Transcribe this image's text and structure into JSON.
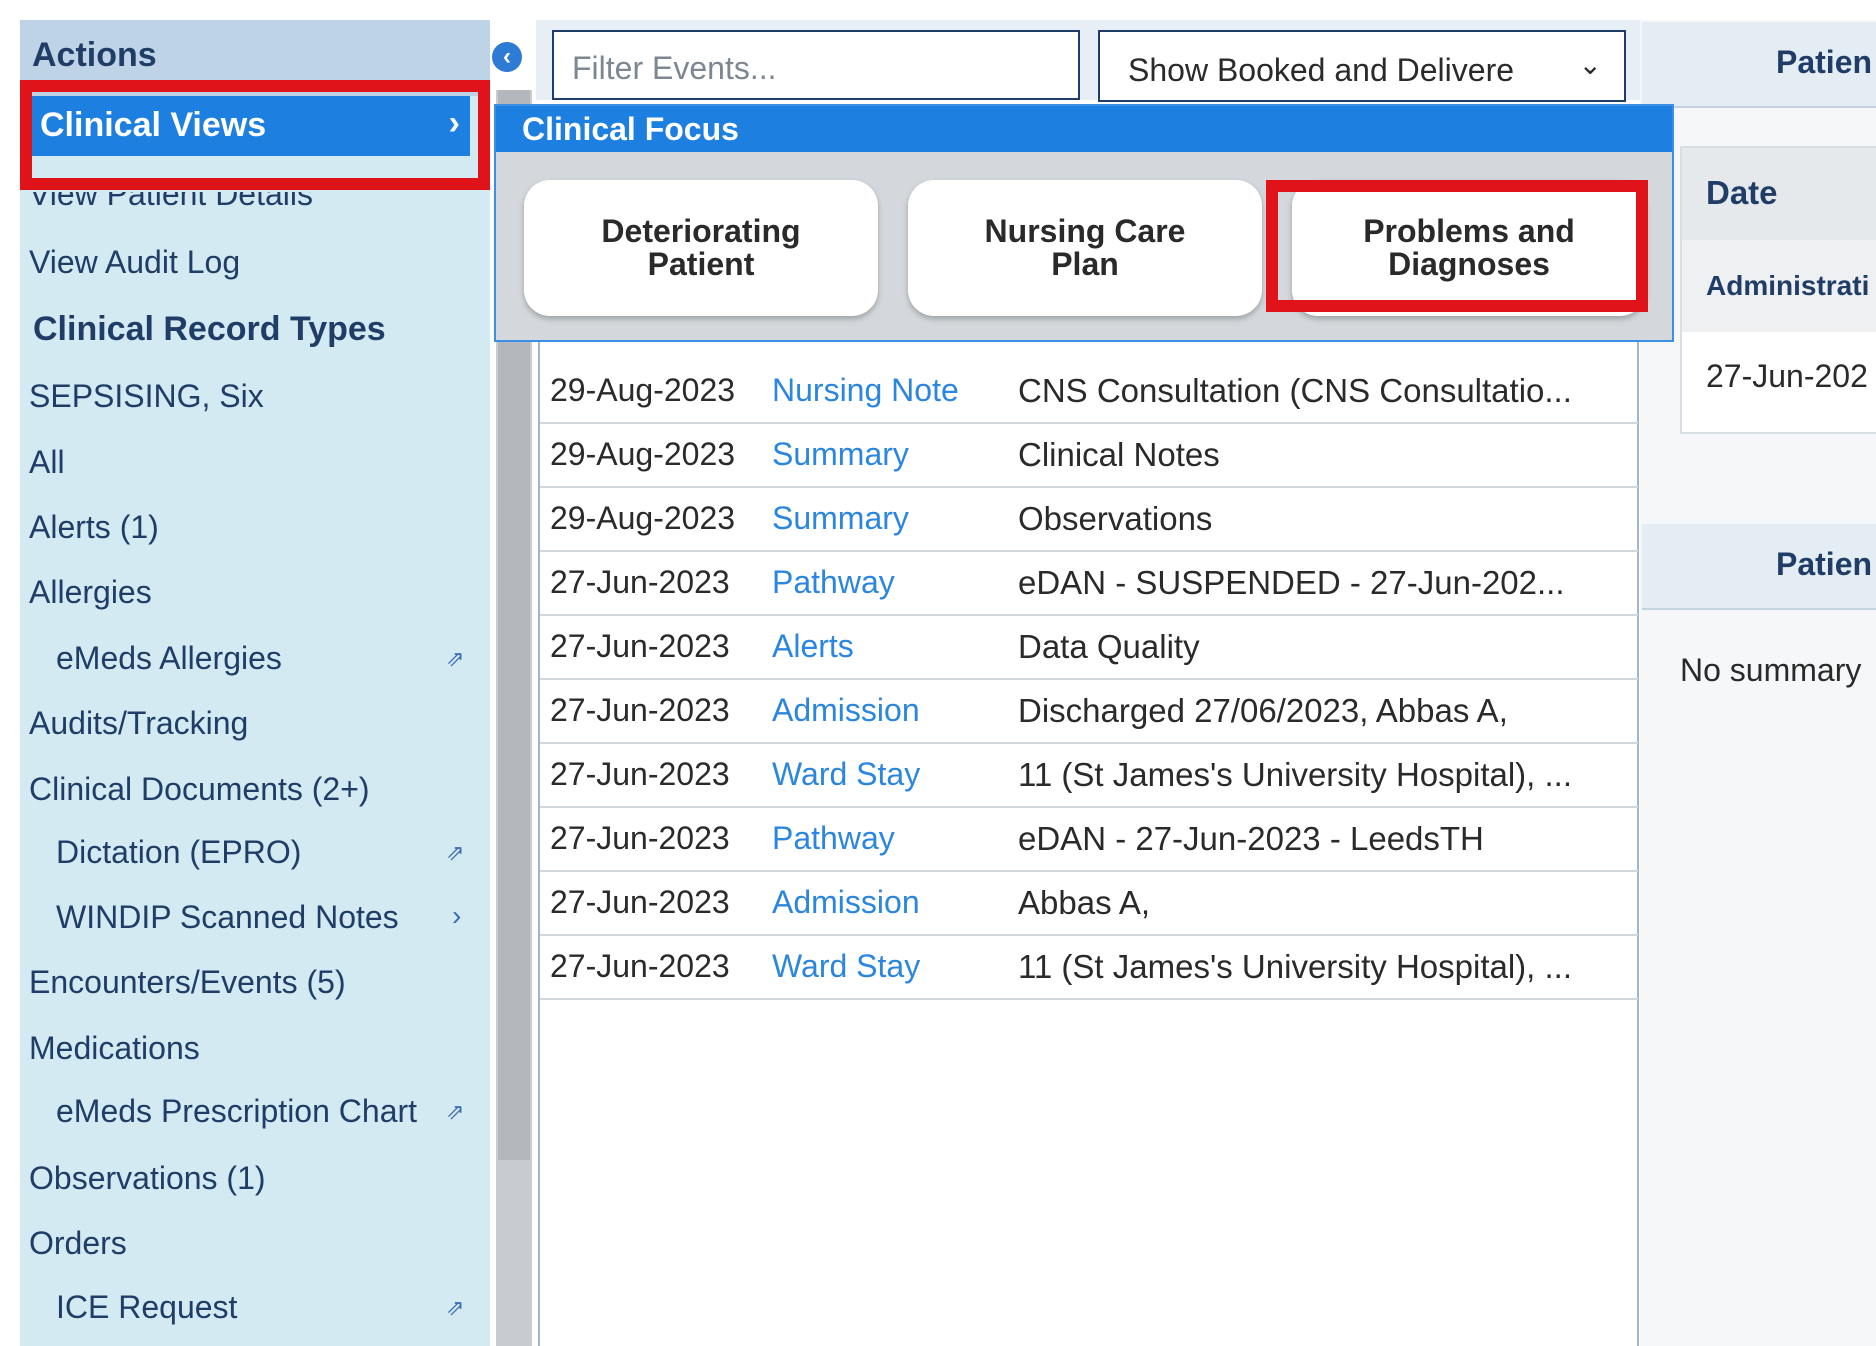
{
  "sidebar": {
    "header": "Actions",
    "clinical_views": "Clinical Views",
    "items": [
      {
        "label": "View Patient Details"
      },
      {
        "label": "View Audit Log"
      },
      {
        "label": "Clinical Record Types"
      },
      {
        "label": "SEPSISING, Six"
      },
      {
        "label": "All"
      },
      {
        "label": "Alerts (1)"
      },
      {
        "label": "Allergies"
      },
      {
        "label": "eMeds Allergies"
      },
      {
        "label": "Audits/Tracking"
      },
      {
        "label": "Clinical Documents (2+)"
      },
      {
        "label": "Dictation (EPRO)"
      },
      {
        "label": "WINDIP Scanned Notes"
      },
      {
        "label": "Encounters/Events (5)"
      },
      {
        "label": "Medications"
      },
      {
        "label": "eMeds Prescription Chart"
      },
      {
        "label": "Observations (1)"
      },
      {
        "label": "Orders"
      },
      {
        "label": "ICE Request"
      }
    ]
  },
  "toolbar": {
    "filter_placeholder": "Filter Events...",
    "show_select_value": "Show Booked and Delivere"
  },
  "popup": {
    "title": "Clinical Focus",
    "buttons": [
      {
        "label": "Deteriorating Patient"
      },
      {
        "label": "Nursing Care Plan"
      },
      {
        "label": "Problems and Diagnoses"
      }
    ]
  },
  "events": [
    {
      "date": "29-Aug-2023",
      "type": "Nursing Note",
      "desc": "CNS Consultation (CNS Consultatio..."
    },
    {
      "date": "29-Aug-2023",
      "type": "Summary",
      "desc": "Clinical Notes"
    },
    {
      "date": "29-Aug-2023",
      "type": "Summary",
      "desc": "Observations"
    },
    {
      "date": "27-Jun-2023",
      "type": "Pathway",
      "desc": "eDAN - SUSPENDED - 27-Jun-202..."
    },
    {
      "date": "27-Jun-2023",
      "type": "Alerts",
      "desc": "Data Quality"
    },
    {
      "date": "27-Jun-2023",
      "type": "Admission",
      "desc": "Discharged 27/06/2023, Abbas A,"
    },
    {
      "date": "27-Jun-2023",
      "type": "Ward Stay",
      "desc": "11 (St James's University Hospital), ..."
    },
    {
      "date": "27-Jun-2023",
      "type": "Pathway",
      "desc": "eDAN - 27-Jun-2023 - LeedsTH"
    },
    {
      "date": "27-Jun-2023",
      "type": "Admission",
      "desc": "Abbas A,"
    },
    {
      "date": "27-Jun-2023",
      "type": "Ward Stay",
      "desc": "11 (St James's University Hospital), ..."
    }
  ],
  "right_panel": {
    "head1": "Patien",
    "table_header": "Date",
    "table_sub": "Administrati",
    "table_row": "27-Jun-202",
    "head2": "Patien",
    "no_summary": "No summary"
  },
  "colors": {
    "accent": "#1d7fe0",
    "highlight": "#e0121a",
    "link": "#2a86e0"
  }
}
